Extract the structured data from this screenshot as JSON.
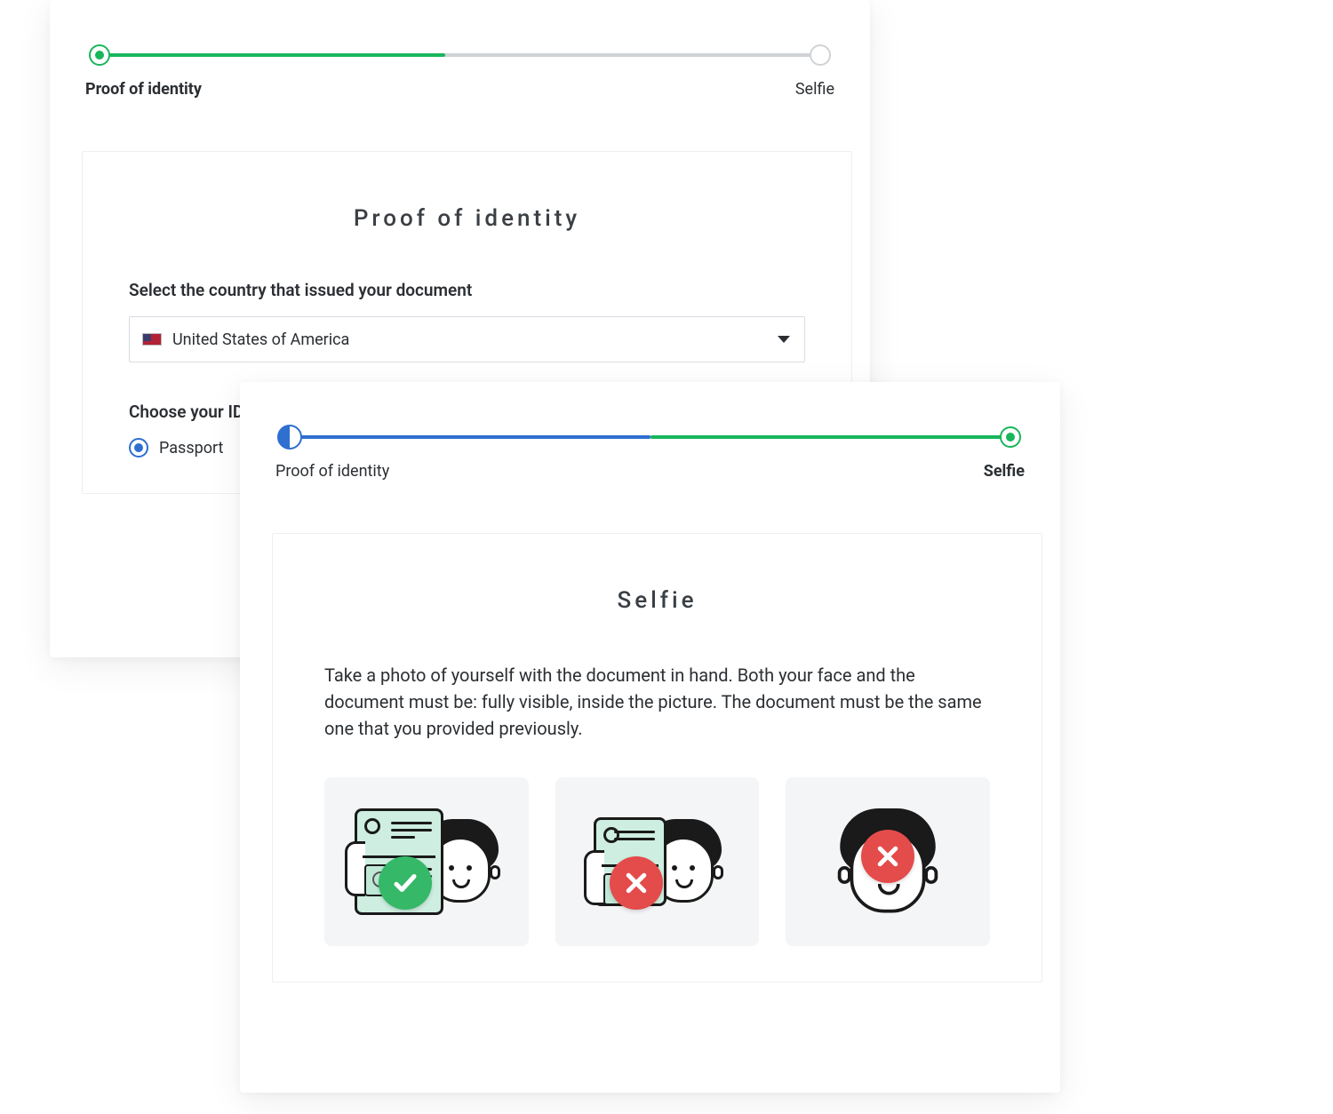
{
  "stepper": {
    "step1_label": "Proof of identity",
    "step2_label": "Selfie"
  },
  "cardA": {
    "title": "Proof of identity",
    "country_label": "Select the country that issued your document",
    "country_selected": "United States of America",
    "idtype_label": "Choose your ID type",
    "idtype_option1": "Passport"
  },
  "cardB": {
    "title": "Selfie",
    "description": "Take a photo of yourself with the document in hand. Both your face and the document must be: fully visible, inside the picture. The document must be the same one that you provided previously.",
    "examples": [
      {
        "status": "ok"
      },
      {
        "status": "bad"
      },
      {
        "status": "bad"
      }
    ]
  },
  "colors": {
    "green": "#18b65b",
    "blue": "#2f6fd0",
    "red": "#e44b4b"
  }
}
